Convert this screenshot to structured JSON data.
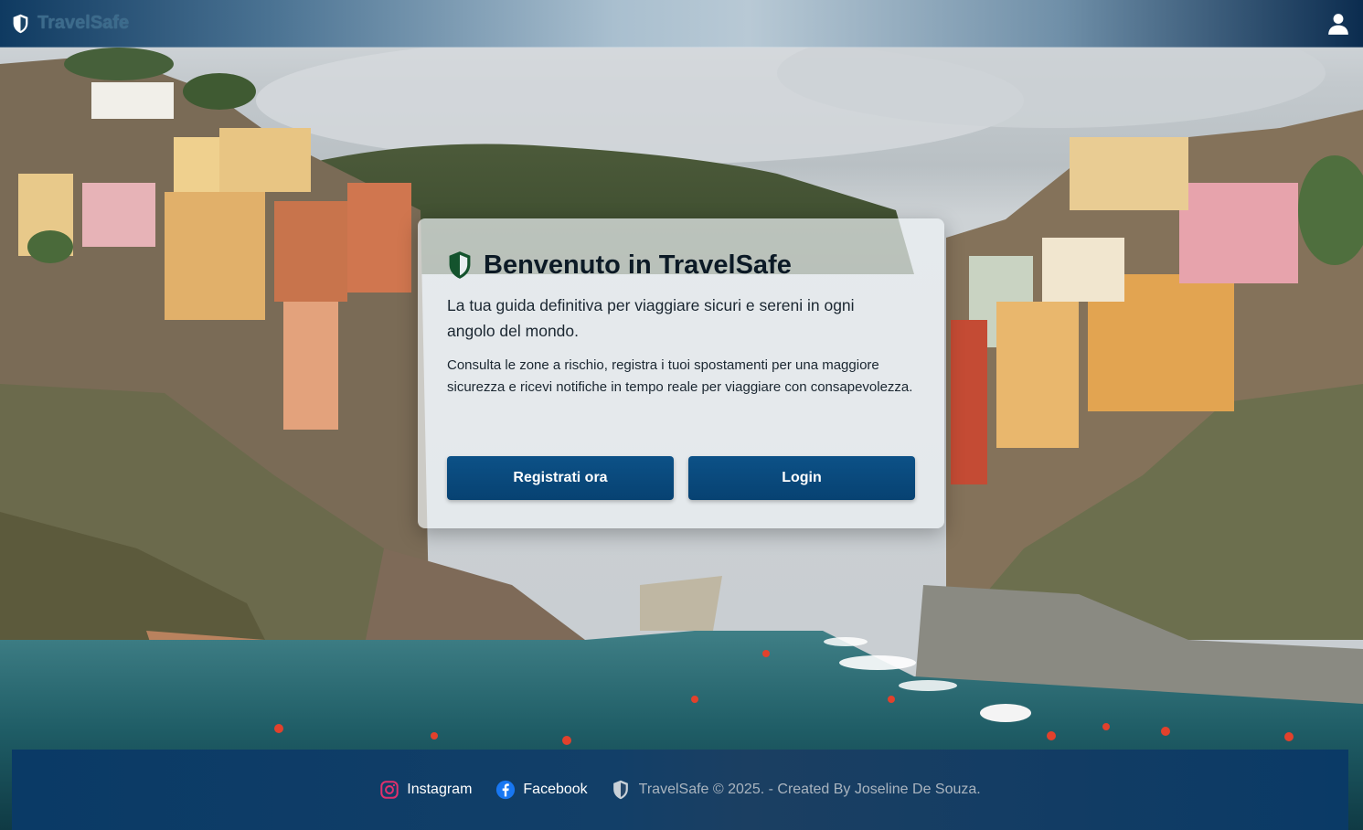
{
  "header": {
    "brand_name": "TravelSafe",
    "brand_icon": "shield-icon",
    "user_icon": "user-icon"
  },
  "welcome": {
    "title": "Benvenuto in TravelSafe",
    "title_icon": "shield-icon",
    "intro": "La tua guida definitiva per viaggiare sicuri e sereni in ogni angolo del mondo.",
    "details": "Consulta le zone a rischio, registra i tuoi spostamenti per una maggiore sicurezza e ricevi notifiche in tempo reale per viaggiare con consapevolezza.",
    "register_label": "Registrati ora",
    "login_label": "Login"
  },
  "footer": {
    "instagram_label": "Instagram",
    "facebook_label": "Facebook",
    "credits": "TravelSafe © 2025. - Created By Joseline De Souza."
  },
  "colors": {
    "primary_button": "#0a4a7f",
    "footer_bg": "#0a3a66",
    "instagram": "#e1306c",
    "facebook": "#1877f2"
  }
}
